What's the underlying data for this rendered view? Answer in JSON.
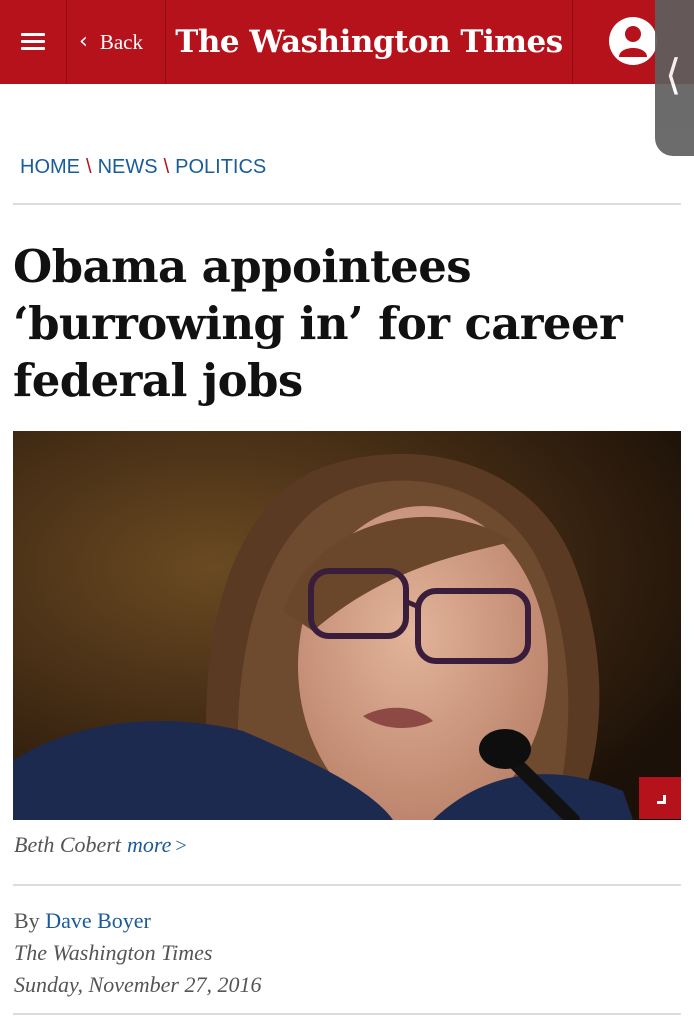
{
  "header": {
    "menu_icon": "hamburger-icon",
    "back_label": "Back",
    "logo_text": "The Washington Times",
    "account_icon": "user-icon",
    "brand_color": "#b5121b"
  },
  "side_tab": {
    "icon": "chevron-left-icon"
  },
  "breadcrumb": {
    "items": [
      "HOME",
      "NEWS",
      "POLITICS"
    ],
    "separator": "\\"
  },
  "article": {
    "headline": "Obama appointees ‘burrowing in’ for career federal jobs",
    "photo_expand_icon": "expand-arrow-icon",
    "caption": "Beth Cobert",
    "caption_more": "more",
    "caption_more_arrow": ">",
    "by_label": "By",
    "author": "Dave Boyer",
    "publication": "The Washington Times",
    "date": "Sunday, November 27, 2016"
  }
}
